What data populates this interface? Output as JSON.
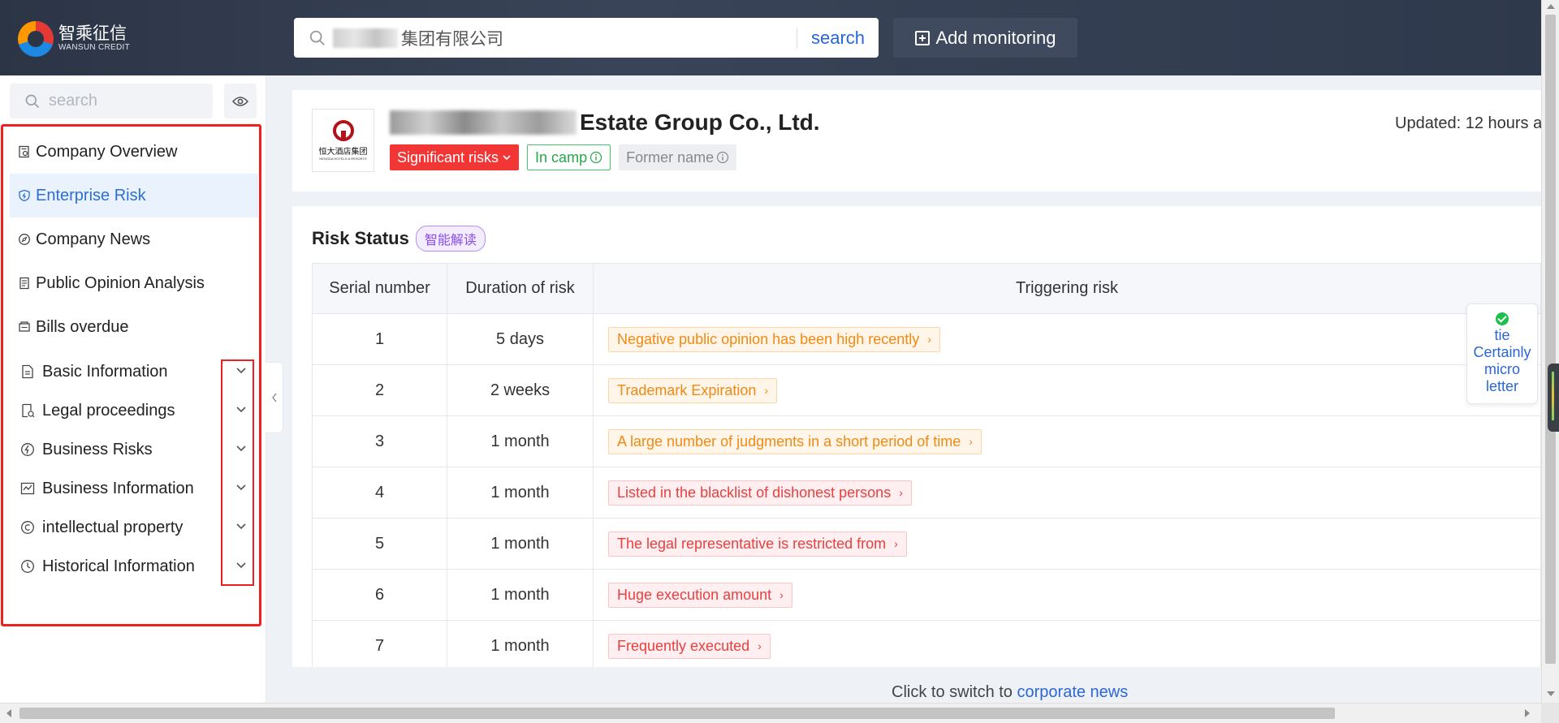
{
  "header": {
    "logo_cn": "智乘征信",
    "logo_en": "WANSUN CREDIT",
    "search_value_suffix": "集团有限公司",
    "search_button": "search",
    "add_monitoring": "Add monitoring"
  },
  "sidebar": {
    "search_placeholder": "search",
    "nav_items": [
      {
        "label": "Company Overview",
        "icon": "overview-icon",
        "active": false
      },
      {
        "label": "Enterprise Risk",
        "icon": "shield-icon",
        "active": true
      },
      {
        "label": "Company News",
        "icon": "compass-icon",
        "active": false
      },
      {
        "label": "Public Opinion Analysis",
        "icon": "newspaper-icon",
        "active": false
      },
      {
        "label": "Bills overdue",
        "icon": "bill-icon",
        "active": false
      }
    ],
    "groups": [
      {
        "label": "Basic Information",
        "icon": "document-icon"
      },
      {
        "label": "Legal proceedings",
        "icon": "legal-doc-icon"
      },
      {
        "label": "Business Risks",
        "icon": "lightning-icon"
      },
      {
        "label": "Business Information",
        "icon": "chart-icon"
      },
      {
        "label": "intellectual property",
        "icon": "copyright-icon"
      },
      {
        "label": "Historical Information",
        "icon": "clock-icon"
      }
    ]
  },
  "company": {
    "logo_cn": "恒大酒店集团",
    "logo_en": "HENGDA HOTELS & RESORTS",
    "name_suffix": "Estate Group Co., Ltd.",
    "tags": {
      "significant_risks": "Significant risks",
      "in_camp": "In camp",
      "former_name": "Former name"
    },
    "updated": "Updated: 12 hours a"
  },
  "risk_status": {
    "title": "Risk Status",
    "ai_badge": "智能解读",
    "columns": [
      "Serial number",
      "Duration of risk",
      "Triggering risk"
    ],
    "rows": [
      {
        "serial": "1",
        "duration": "5 days",
        "risk": "Negative public opinion has been high recently",
        "level": "orange"
      },
      {
        "serial": "2",
        "duration": "2 weeks",
        "risk": "Trademark Expiration",
        "level": "orange"
      },
      {
        "serial": "3",
        "duration": "1 month",
        "risk": "A large number of judgments in a short period of time",
        "level": "orange"
      },
      {
        "serial": "4",
        "duration": "1 month",
        "risk": "Listed in the blacklist of dishonest persons",
        "level": "red"
      },
      {
        "serial": "5",
        "duration": "1 month",
        "risk": "The legal representative is restricted from",
        "level": "red"
      },
      {
        "serial": "6",
        "duration": "1 month",
        "risk": "Huge execution amount",
        "level": "red"
      },
      {
        "serial": "7",
        "duration": "1 month",
        "risk": "Frequently executed",
        "level": "red"
      }
    ]
  },
  "footer": {
    "prefix": "Click to switch to",
    "link": "corporate news"
  },
  "float_panel": {
    "text": "tie Certainly micro letter"
  },
  "colors": {
    "accent_blue": "#2b66d6",
    "risk_orange": "#f08a14",
    "risk_red": "#e84040",
    "tag_red": "#f23535",
    "tag_green": "#24a848",
    "highlight_frame": "#f02020"
  }
}
